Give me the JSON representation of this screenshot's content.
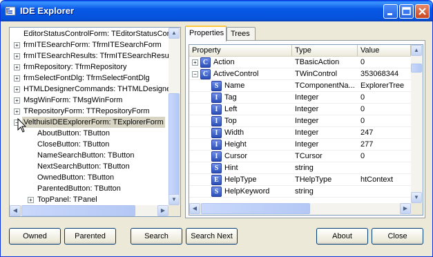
{
  "window": {
    "title": "IDE Explorer",
    "minimize_label": "minimize",
    "maximize_label": "maximize",
    "close_label": "close"
  },
  "tree": {
    "items": [
      {
        "label": "EditorStatusControlForm: TEditorStatusCon",
        "level": 0,
        "expander": "none"
      },
      {
        "label": "frmITESearchForm: TfrmITESearchForm",
        "level": 0,
        "expander": "+"
      },
      {
        "label": "frmITESearchResults: TfrmITESearchResult",
        "level": 0,
        "expander": "+"
      },
      {
        "label": "frmRepository: TfrmRepository",
        "level": 0,
        "expander": "+"
      },
      {
        "label": "frmSelectFontDlg: TfrmSelectFontDlg",
        "level": 0,
        "expander": "+"
      },
      {
        "label": "HTMLDesignerCommands: THTMLDesignerC",
        "level": 0,
        "expander": "+"
      },
      {
        "label": "MsgWinForm: TMsgWinForm",
        "level": 0,
        "expander": "+"
      },
      {
        "label": "TRepositoryForm: TTRepositoryForm",
        "level": 0,
        "expander": "+"
      },
      {
        "label": "VelthuisIDEExplorerForm: TExplorerForm",
        "level": 0,
        "expander": "-",
        "selected": true
      },
      {
        "label": "AboutButton: TButton",
        "level": 1,
        "expander": "none"
      },
      {
        "label": "CloseButton: TButton",
        "level": 1,
        "expander": "none"
      },
      {
        "label": "NameSearchButton: TButton",
        "level": 1,
        "expander": "none"
      },
      {
        "label": "NextSearchButton: TButton",
        "level": 1,
        "expander": "none"
      },
      {
        "label": "OwnedButton: TButton",
        "level": 1,
        "expander": "none"
      },
      {
        "label": "ParentedButton: TButton",
        "level": 1,
        "expander": "none"
      },
      {
        "label": "TopPanel: TPanel",
        "level": 1,
        "expander": "+"
      }
    ]
  },
  "tabs": [
    {
      "label": "Properties",
      "active": true
    },
    {
      "label": "Trees",
      "active": false
    }
  ],
  "grid": {
    "columns": [
      "Property",
      "Type",
      "Value"
    ],
    "rows": [
      {
        "expander": "+",
        "icon": "C",
        "indent": 0,
        "name": "Action",
        "type": "TBasicAction",
        "value": "0"
      },
      {
        "expander": "-",
        "icon": "C",
        "indent": 0,
        "name": "ActiveControl",
        "type": "TWinControl",
        "value": "353068344"
      },
      {
        "expander": "none",
        "icon": "S",
        "indent": 1,
        "name": "Name",
        "type": "TComponentNa...",
        "value": "ExplorerTree"
      },
      {
        "expander": "none",
        "icon": "I",
        "indent": 1,
        "name": "Tag",
        "type": "Integer",
        "value": "0"
      },
      {
        "expander": "none",
        "icon": "I",
        "indent": 1,
        "name": "Left",
        "type": "Integer",
        "value": "0"
      },
      {
        "expander": "none",
        "icon": "I",
        "indent": 1,
        "name": "Top",
        "type": "Integer",
        "value": "0"
      },
      {
        "expander": "none",
        "icon": "I",
        "indent": 1,
        "name": "Width",
        "type": "Integer",
        "value": "247"
      },
      {
        "expander": "none",
        "icon": "I",
        "indent": 1,
        "name": "Height",
        "type": "Integer",
        "value": "277"
      },
      {
        "expander": "none",
        "icon": "I",
        "indent": 1,
        "name": "Cursor",
        "type": "TCursor",
        "value": "0"
      },
      {
        "expander": "none",
        "icon": "S",
        "indent": 1,
        "name": "Hint",
        "type": "string",
        "value": ""
      },
      {
        "expander": "none",
        "icon": "E",
        "indent": 1,
        "name": "HelpType",
        "type": "THelpType",
        "value": "htContext"
      },
      {
        "expander": "none",
        "icon": "S",
        "indent": 1,
        "name": "HelpKeyword",
        "type": "string",
        "value": ""
      }
    ]
  },
  "buttons": {
    "owned": "Owned",
    "parented": "Parented",
    "search": "Search",
    "search_next": "Search Next",
    "about": "About",
    "close": "Close"
  },
  "icons": {
    "app": "tree-app-icon",
    "minimize": "minimize-icon",
    "maximize": "maximize-icon",
    "close": "close-icon",
    "type_class": "class-type-icon",
    "type_string": "string-type-icon",
    "type_integer": "integer-type-icon",
    "type_enum": "enum-type-icon"
  },
  "colors": {
    "titlebar": "#0858e6",
    "window_face": "#ece9d8",
    "selection": "#d8d4c4",
    "type_icon": "#2b4fb6"
  }
}
